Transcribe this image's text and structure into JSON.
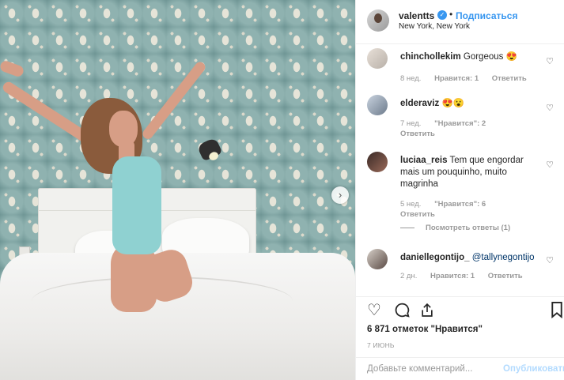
{
  "header": {
    "username": "valentts",
    "verified_icon": "verified-check-icon",
    "separator": "•",
    "follow_label": "Подписаться",
    "location": "New York, New York"
  },
  "photo": {
    "next_icon": "chevron-right-icon"
  },
  "comments": [
    {
      "username": "chinchollekim",
      "text": "Gorgeous 😍",
      "time": "8 нед.",
      "likes": "Нравится: 1",
      "reply": "Ответить"
    },
    {
      "username": "elderaviz",
      "text": "😍😮",
      "time": "7 нед.",
      "likes": "\"Нравится\": 2",
      "reply": "Ответить"
    },
    {
      "username": "luciaa_reis",
      "text": "Tem que engordar mais um pouquinho, muito magrinha",
      "time": "5 нед.",
      "likes": "\"Нравится\": 6",
      "reply": "Ответить",
      "view_replies": "Посмотреть ответы (1)"
    },
    {
      "username": "daniellegontijo_",
      "mention": "@tallynegontijo",
      "time": "2 дн.",
      "likes": "Нравится: 1",
      "reply": "Ответить"
    }
  ],
  "actions": {
    "like_icon": "heart-icon",
    "comment_icon": "comment-icon",
    "share_icon": "share-icon",
    "save_icon": "bookmark-icon"
  },
  "likes_text": "6 871 отметок \"Нравится\"",
  "date": "7 ИЮНЬ",
  "comment_box": {
    "placeholder": "Добавьте комментарий...",
    "publish_label": "Опубликовать"
  }
}
